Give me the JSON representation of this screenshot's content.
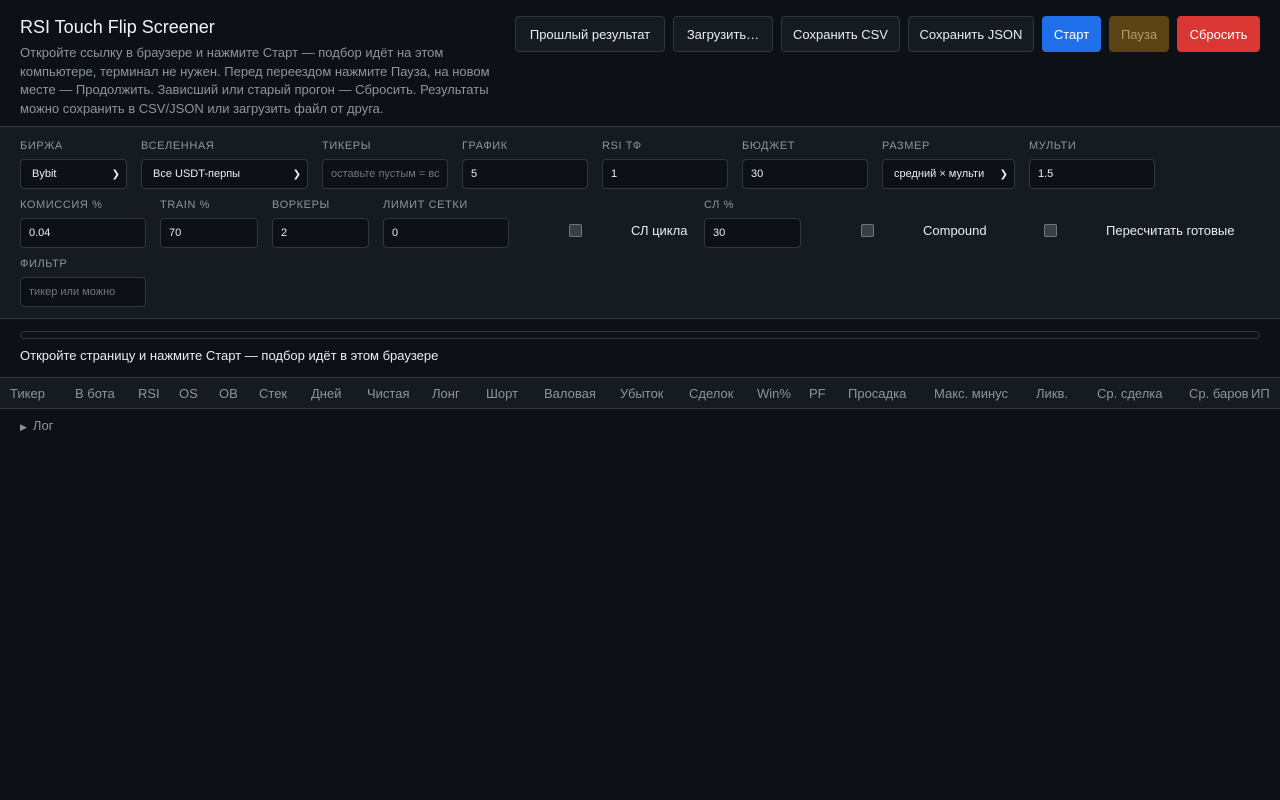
{
  "header": {
    "title": "RSI Touch Flip Screener",
    "description": "Откройте ссылку в браузере и нажмите Старт — подбор идёт на этом компьютере, терминал не нужен. Перед переездом нажмите Пауза, на новом месте — Продолжить. Зависший или старый прогон — Сбросить. Результаты можно сохранить в CSV/JSON или загрузить файл от друга."
  },
  "toolbar": {
    "prev_result": "Прошлый результат",
    "load": "Загрузить…",
    "save_csv": "Сохранить CSV",
    "save_json": "Сохранить JSON",
    "start": "Старт",
    "pause": "Пауза",
    "reset": "Сбросить"
  },
  "settings": {
    "exchange": {
      "label": "БИРЖА",
      "value": "Bybit"
    },
    "universe": {
      "label": "ВСЕЛЕННАЯ",
      "value": "Все USDT-перпы"
    },
    "tickers": {
      "label": "ТИКЕРЫ",
      "placeholder": "оставьте пустым = вс"
    },
    "chart": {
      "label": "ГРАФИК",
      "value": "5"
    },
    "rsi_tf": {
      "label": "RSI ТФ",
      "value": "1"
    },
    "budget": {
      "label": "БЮДЖЕТ",
      "value": "30"
    },
    "size": {
      "label": "РАЗМЕР",
      "value": "средний × мульти"
    },
    "multi": {
      "label": "МУЛЬТИ",
      "value": "1.5"
    },
    "commission": {
      "label": "КОМИССИЯ %",
      "value": "0.04"
    },
    "train": {
      "label": "TRAIN %",
      "value": "70"
    },
    "workers": {
      "label": "ВОРКЕРЫ",
      "value": "2"
    },
    "grid_limit": {
      "label": "ЛИМИТ СЕТКИ",
      "value": "0"
    },
    "sl_cycle": {
      "label": "СЛ цикла",
      "checked": false
    },
    "sl_pct": {
      "label": "СЛ %",
      "value": "30"
    },
    "compound": {
      "label": "Compound",
      "checked": false
    },
    "recalc": {
      "label": "Пересчитать готовые",
      "checked": false
    },
    "filter": {
      "label": "ФИЛЬТР",
      "placeholder": "тикер или можно"
    }
  },
  "progress": {
    "fraction": 0
  },
  "status_text": "Откройте страницу и нажмите Старт — подбор идёт в этом браузере",
  "table": {
    "columns": [
      "Тикер",
      "В бота",
      "RSI",
      "OS",
      "OB",
      "Стек",
      "Дней",
      "Чистая",
      "Лонг",
      "Шорт",
      "Валовая",
      "Убыток",
      "Сделок",
      "Win%",
      "PF",
      "Просадка",
      "Макс. минус",
      "Ликв.",
      "Ср. сделка",
      "Ср. баров",
      "ИП"
    ]
  },
  "log": {
    "label": "Лог"
  }
}
